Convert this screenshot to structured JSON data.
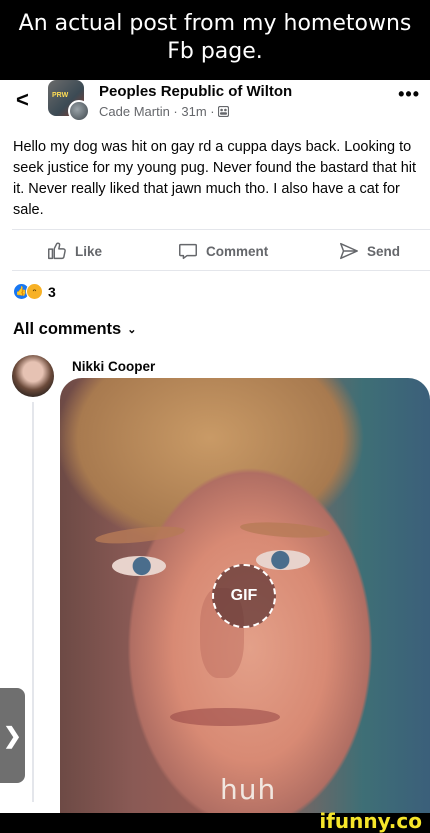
{
  "meme": {
    "caption_line1": "An actual post from my hometowns",
    "caption_line2": "Fb page.",
    "watermark": "ifunny.co"
  },
  "post": {
    "back_icon": "<",
    "group_name": "Peoples Republic of Wilton",
    "author": "Cade Martin",
    "time": "31m",
    "meta_text": "Cade Martin · 31m · ",
    "more_icon": "•••",
    "text": "Hello my dog was hit on gay rd a cuppa days back. Looking to seek justice for my young pug. Never found the bastard that hit it. Never really liked that jawn much tho. I also have a cat for sale."
  },
  "actions": {
    "like": "Like",
    "comment": "Comment",
    "send": "Send"
  },
  "reactions": {
    "count": "3"
  },
  "comments": {
    "header": "All comments",
    "chevron": "⌄",
    "first": {
      "name": "Nikki Cooper",
      "gif_badge": "GIF",
      "gif_caption": "huh"
    }
  },
  "side_handle": "❯",
  "colors": {
    "secondary_text": "#65676b",
    "like_blue": "#1877f2",
    "divider": "#e4e6eb",
    "watermark_yellow": "#f6e52a"
  }
}
